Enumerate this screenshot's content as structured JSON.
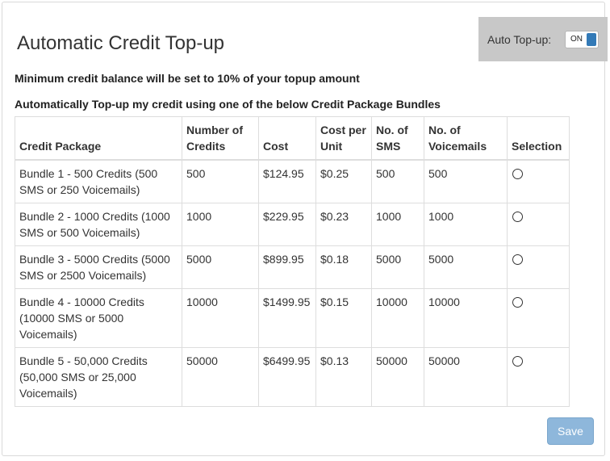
{
  "title": "Automatic Credit Top-up",
  "auto_topup": {
    "label": "Auto Top-up:",
    "toggle_text": "ON",
    "enabled": true
  },
  "info": {
    "min_balance": "Minimum credit balance will be set to 10% of your topup amount",
    "instruction": "Automatically Top-up my credit using one of the below Credit Package Bundles"
  },
  "table": {
    "headers": [
      "Credit Package",
      "Number of Credits",
      "Cost",
      "Cost per Unit",
      "No. of SMS",
      "No. of Voicemails",
      "Selection"
    ],
    "rows": [
      {
        "package": "Bundle 1 - 500 Credits (500 SMS or 250 Voicemails)",
        "credits": "500",
        "cost": "$124.95",
        "cost_per_unit": "$0.25",
        "sms": "500",
        "voicemails": "500",
        "selected": false
      },
      {
        "package": "Bundle 2 - 1000 Credits (1000 SMS or 500 Voicemails)",
        "credits": "1000",
        "cost": "$229.95",
        "cost_per_unit": "$0.23",
        "sms": "1000",
        "voicemails": "1000",
        "selected": false
      },
      {
        "package": "Bundle 3 - 5000 Credits (5000 SMS or 2500 Voicemails)",
        "credits": "5000",
        "cost": "$899.95",
        "cost_per_unit": "$0.18",
        "sms": "5000",
        "voicemails": "5000",
        "selected": false
      },
      {
        "package": "Bundle 4 - 10000 Credits (10000 SMS or 5000 Voicemails)",
        "credits": "10000",
        "cost": "$1499.95",
        "cost_per_unit": "$0.15",
        "sms": "10000",
        "voicemails": "10000",
        "selected": false
      },
      {
        "package": "Bundle 5 - 50,000 Credits (50,000 SMS or 25,000 Voicemails)",
        "credits": "50000",
        "cost": "$6499.95",
        "cost_per_unit": "$0.13",
        "sms": "50000",
        "voicemails": "50000",
        "selected": false
      }
    ]
  },
  "save_label": "Save",
  "colors": {
    "toggle_accent": "#337ab7",
    "save_button": "#8eb7db",
    "auto_topup_background": "#c8c8c8"
  }
}
